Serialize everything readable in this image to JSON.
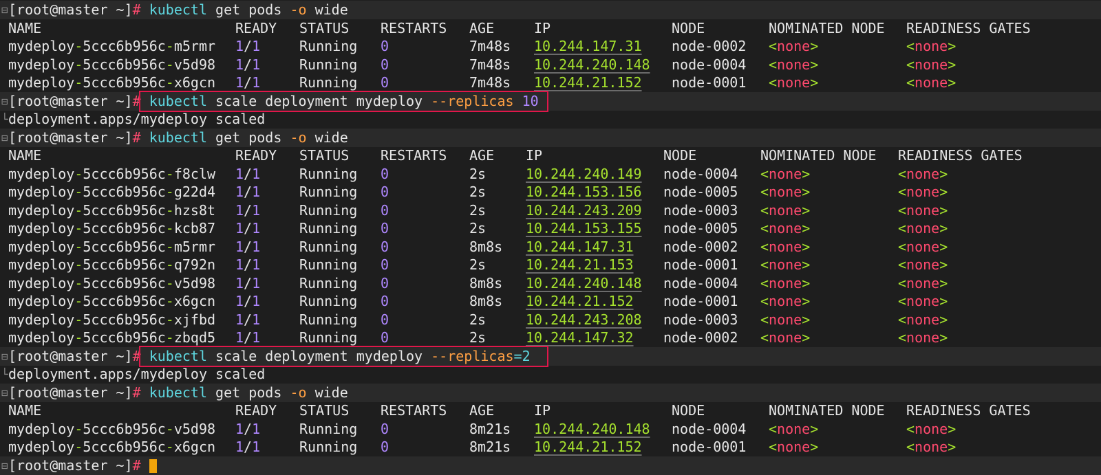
{
  "prompt": "[root@master ~]",
  "hash": "#",
  "cmd_get": {
    "exe": "kubectl",
    "args": " get pods ",
    "flag": "-o",
    "rest": " wide"
  },
  "cmd_scale10": {
    "exe": "kubectl",
    "args": " scale deployment mydeploy ",
    "flag": "--replicas",
    "sp": " ",
    "num": "10"
  },
  "cmd_scale2": {
    "exe": "kubectl",
    "args": " scale deployment mydeploy ",
    "flag": "--replicas",
    "eq": "=",
    "num": "2"
  },
  "scaled_output": "deployment.apps/mydeploy scaled",
  "headers": [
    "NAME",
    "READY",
    "STATUS",
    "RESTARTS",
    "AGE",
    "IP",
    "NODE",
    "NOMINATED NODE",
    "READINESS GATES"
  ],
  "table1": [
    {
      "name": "mydeploy-5ccc6b956c-m5rmr",
      "ready": "1/1",
      "status": "Running",
      "restarts": "0",
      "age": "7m48s",
      "ip": "10.244.147.31",
      "node": "node-0002",
      "nominated": "<none>",
      "gates": "<none>"
    },
    {
      "name": "mydeploy-5ccc6b956c-v5d98",
      "ready": "1/1",
      "status": "Running",
      "restarts": "0",
      "age": "7m48s",
      "ip": "10.244.240.148",
      "node": "node-0004",
      "nominated": "<none>",
      "gates": "<none>"
    },
    {
      "name": "mydeploy-5ccc6b956c-x6gcn",
      "ready": "1/1",
      "status": "Running",
      "restarts": "0",
      "age": "7m48s",
      "ip": "10.244.21.152",
      "node": "node-0001",
      "nominated": "<none>",
      "gates": "<none>"
    }
  ],
  "table2": [
    {
      "name": "mydeploy-5ccc6b956c-f8clw",
      "ready": "1/1",
      "status": "Running",
      "restarts": "0",
      "age": "2s",
      "ip": "10.244.240.149",
      "node": "node-0004",
      "nominated": "<none>",
      "gates": "<none>"
    },
    {
      "name": "mydeploy-5ccc6b956c-g22d4",
      "ready": "1/1",
      "status": "Running",
      "restarts": "0",
      "age": "2s",
      "ip": "10.244.153.156",
      "node": "node-0005",
      "nominated": "<none>",
      "gates": "<none>"
    },
    {
      "name": "mydeploy-5ccc6b956c-hzs8t",
      "ready": "1/1",
      "status": "Running",
      "restarts": "0",
      "age": "2s",
      "ip": "10.244.243.209",
      "node": "node-0003",
      "nominated": "<none>",
      "gates": "<none>"
    },
    {
      "name": "mydeploy-5ccc6b956c-kcb87",
      "ready": "1/1",
      "status": "Running",
      "restarts": "0",
      "age": "2s",
      "ip": "10.244.153.155",
      "node": "node-0005",
      "nominated": "<none>",
      "gates": "<none>"
    },
    {
      "name": "mydeploy-5ccc6b956c-m5rmr",
      "ready": "1/1",
      "status": "Running",
      "restarts": "0",
      "age": "8m8s",
      "ip": "10.244.147.31",
      "node": "node-0002",
      "nominated": "<none>",
      "gates": "<none>"
    },
    {
      "name": "mydeploy-5ccc6b956c-q792n",
      "ready": "1/1",
      "status": "Running",
      "restarts": "0",
      "age": "2s",
      "ip": "10.244.21.153",
      "node": "node-0001",
      "nominated": "<none>",
      "gates": "<none>"
    },
    {
      "name": "mydeploy-5ccc6b956c-v5d98",
      "ready": "1/1",
      "status": "Running",
      "restarts": "0",
      "age": "8m8s",
      "ip": "10.244.240.148",
      "node": "node-0004",
      "nominated": "<none>",
      "gates": "<none>"
    },
    {
      "name": "mydeploy-5ccc6b956c-x6gcn",
      "ready": "1/1",
      "status": "Running",
      "restarts": "0",
      "age": "8m8s",
      "ip": "10.244.21.152",
      "node": "node-0001",
      "nominated": "<none>",
      "gates": "<none>"
    },
    {
      "name": "mydeploy-5ccc6b956c-xjfbd",
      "ready": "1/1",
      "status": "Running",
      "restarts": "0",
      "age": "2s",
      "ip": "10.244.243.208",
      "node": "node-0003",
      "nominated": "<none>",
      "gates": "<none>"
    },
    {
      "name": "mydeploy-5ccc6b956c-zbqd5",
      "ready": "1/1",
      "status": "Running",
      "restarts": "0",
      "age": "2s",
      "ip": "10.244.147.32",
      "node": "node-0002",
      "nominated": "<none>",
      "gates": "<none>"
    }
  ],
  "table3": [
    {
      "name": "mydeploy-5ccc6b956c-v5d98",
      "ready": "1/1",
      "status": "Running",
      "restarts": "0",
      "age": "8m21s",
      "ip": "10.244.240.148",
      "node": "node-0004",
      "nominated": "<none>",
      "gates": "<none>"
    },
    {
      "name": "mydeploy-5ccc6b956c-x6gcn",
      "ready": "1/1",
      "status": "Running",
      "restarts": "0",
      "age": "8m21s",
      "ip": "10.244.21.152",
      "node": "node-0001",
      "nominated": "<none>",
      "gates": "<none>"
    }
  ],
  "colors": {
    "background": "#1e1e1e",
    "prompt_stripe": "#2a2a2a",
    "command": "#5fd7e0",
    "flag": "#ff9f43",
    "number": "#af87ff",
    "hash": "#ff4a6e",
    "ip": "#a6e22e",
    "highlight_box": "#e0174a",
    "cursor": "#f0a30a"
  }
}
